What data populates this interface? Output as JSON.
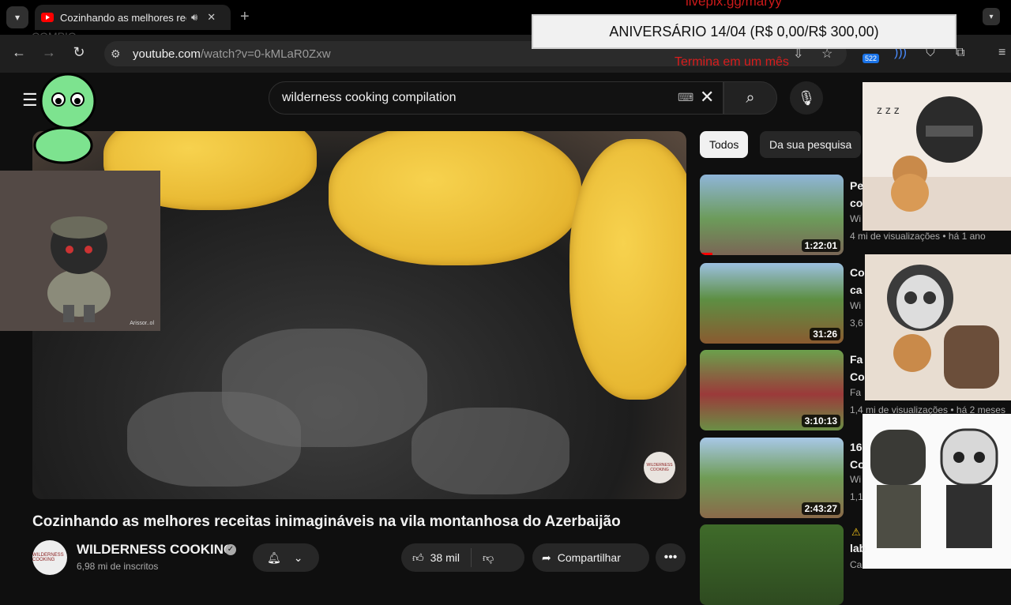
{
  "browser": {
    "tab_title": "Cozinhando as melhores receitas inimagináveis na vila montanhosa do Azerbaijão",
    "url_host": "youtube.com",
    "url_path": "/watch?v=0-kMLaR0Zxw",
    "ghost_text": "COMPIO"
  },
  "overlay": {
    "url_text": "livepix.gg/maryy",
    "banner_text": "ANIVERSÁRIO 14/04 (R$ 0,00/R$ 300,00)",
    "ends_text": "Termina em um mês",
    "extension_badge": "522"
  },
  "search": {
    "query": "wilderness cooking compilation"
  },
  "video": {
    "title": "Cozinhando as melhores receitas inimagináveis na vila montanhosa do Azerbaijão",
    "channel": "WILDERNESS COOKING",
    "subscribers": "6,98 mi de inscritos",
    "likes": "38 mil",
    "share_label": "Compartilhar",
    "watermark": "WILDERNESS COOKING"
  },
  "sidebar": {
    "chips": [
      "Todos",
      "Da sua pesquisa"
    ],
    "recommendations": [
      {
        "duration": "1:22:01",
        "title_frag": "Pe co",
        "channel_frag": "Wi",
        "meta": "4 mi de visualizações • há 1 ano"
      },
      {
        "duration": "31:26",
        "title_frag": "Co ca",
        "channel_frag": "Wi",
        "meta": "3,6"
      },
      {
        "duration": "3:10:13",
        "title_frag": "Fa Co",
        "channel_frag": "Fa",
        "meta": "1,4 mi de visualizações • há 2 meses"
      },
      {
        "duration": "2:43:27",
        "title_frag": "16 Co",
        "channel_frag": "Wi",
        "meta": "1,1"
      },
      {
        "duration": "",
        "title_frag": "lab",
        "channel_frag": "Ca",
        "meta": ""
      }
    ]
  },
  "sticker_text": "Arissor..ol",
  "colors": {
    "youtube_red": "#ff0000",
    "overlay_red": "#d81d1d",
    "chip_active": "#f1f1f1"
  }
}
